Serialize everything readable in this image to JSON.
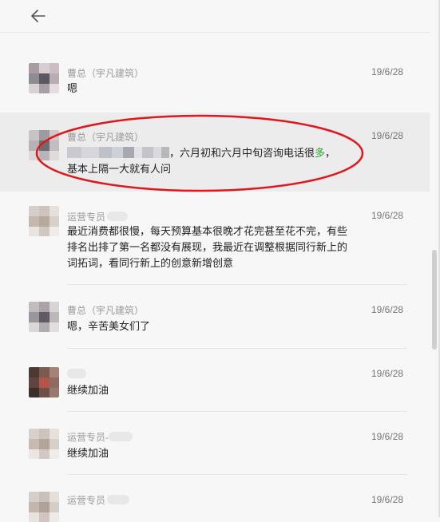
{
  "header": {
    "back_icon": "arrow-left-icon"
  },
  "messages": [
    {
      "sender": "曹总（宇凡建筑）",
      "time": "19/6/28",
      "text": "嗯",
      "highlighted": false
    },
    {
      "sender": "曹总（宇凡建筑）",
      "time": "19/6/28",
      "text_part1": "，六月初和六月中旬咨询电话很",
      "text_green": "多",
      "text_part2": "，",
      "text_line2": "基本上隔一大就有人问",
      "highlighted": true
    },
    {
      "sender": "运营专员",
      "time": "19/6/28",
      "text": "最近消费都很慢，每天预算基本很晚才花完甚至花不完，有些排名出排了第一名都没有展现，我最近在调整根据同行新上的词拓词，看同行新上的创意新增创意",
      "highlighted": false
    },
    {
      "sender": "曹总（宇凡建筑）",
      "time": "19/6/28",
      "text": "嗯，辛苦美女们了",
      "highlighted": false
    },
    {
      "sender": "",
      "time": "19/6/28",
      "text": "继续加油",
      "highlighted": false
    },
    {
      "sender": "运营专员-",
      "time": "19/6/28",
      "text": "继续加油",
      "highlighted": false
    },
    {
      "sender": "运营专员",
      "time": "19/6/28",
      "text": "",
      "highlighted": false
    }
  ],
  "colors": {
    "background": "#f7f7f7",
    "highlight_row": "#ececec",
    "annotation_oval": "#e0161b",
    "accent_green": "#2aa52a"
  }
}
